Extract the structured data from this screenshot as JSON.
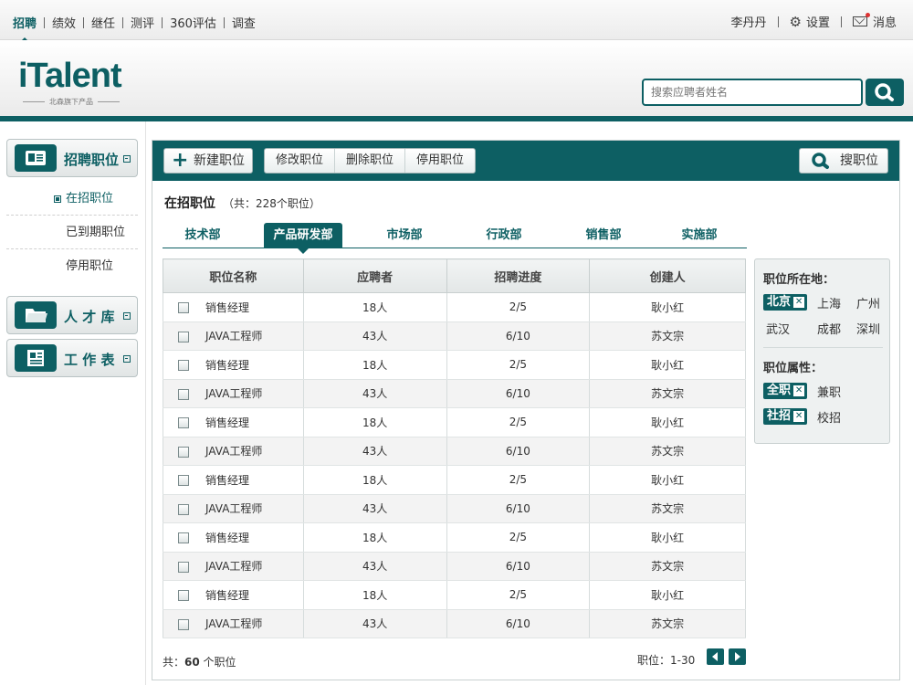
{
  "topnav": {
    "items": [
      "招聘",
      "绩效",
      "继任",
      "测评",
      "360评估",
      "调查"
    ],
    "user": "李丹丹",
    "settings": "设置",
    "messages": "消息"
  },
  "header": {
    "logo": "iTalent",
    "logo_sub": "北森旗下产品",
    "search_placeholder": "搜索应聘者姓名"
  },
  "sidebar": {
    "recruit_label": "招聘职位",
    "sub_items": [
      "在招职位",
      "已到期职位",
      "停用职位"
    ],
    "talent_label": "人 才 库",
    "worksheet_label": "工 作 表"
  },
  "toolbar": {
    "new_label": "新建职位",
    "modify_label": "修改职位",
    "delete_label": "删除职位",
    "disable_label": "停用职位",
    "search_label": "搜职位"
  },
  "main": {
    "title": "在招职位",
    "subtitle": "（共：228个职位）",
    "tabs": [
      "技术部",
      "产品研发部",
      "市场部",
      "行政部",
      "销售部",
      "实施部"
    ],
    "columns": [
      "职位名称",
      "应聘者",
      "招聘进度",
      "创建人"
    ],
    "rows": [
      {
        "name": "销售经理",
        "applicants": "18人",
        "progress": "2/5",
        "creator": "耿小红"
      },
      {
        "name": "JAVA工程师",
        "applicants": "43人",
        "progress": "6/10",
        "creator": "苏文宗"
      },
      {
        "name": "销售经理",
        "applicants": "18人",
        "progress": "2/5",
        "creator": "耿小红"
      },
      {
        "name": "JAVA工程师",
        "applicants": "43人",
        "progress": "6/10",
        "creator": "苏文宗"
      },
      {
        "name": "销售经理",
        "applicants": "18人",
        "progress": "2/5",
        "creator": "耿小红"
      },
      {
        "name": "JAVA工程师",
        "applicants": "43人",
        "progress": "6/10",
        "creator": "苏文宗"
      },
      {
        "name": "销售经理",
        "applicants": "18人",
        "progress": "2/5",
        "creator": "耿小红"
      },
      {
        "name": "JAVA工程师",
        "applicants": "43人",
        "progress": "6/10",
        "creator": "苏文宗"
      },
      {
        "name": "销售经理",
        "applicants": "18人",
        "progress": "2/5",
        "creator": "耿小红"
      },
      {
        "name": "JAVA工程师",
        "applicants": "43人",
        "progress": "6/10",
        "creator": "苏文宗"
      },
      {
        "name": "销售经理",
        "applicants": "18人",
        "progress": "2/5",
        "creator": "耿小红"
      },
      {
        "name": "JAVA工程师",
        "applicants": "43人",
        "progress": "6/10",
        "creator": "苏文宗"
      }
    ],
    "total_prefix": "共：",
    "total": "60",
    "total_suffix": "个职位",
    "pager": "职位：1-30"
  },
  "filter": {
    "location_title": "职位所在地：",
    "locations": [
      "北京",
      "上海",
      "广州",
      "武汉",
      "成都",
      "深圳"
    ],
    "attr_title": "职位属性：",
    "attrs": [
      "全职",
      "兼职",
      "社招",
      "校招"
    ]
  },
  "colors": {
    "brand": "#0d5f63"
  }
}
